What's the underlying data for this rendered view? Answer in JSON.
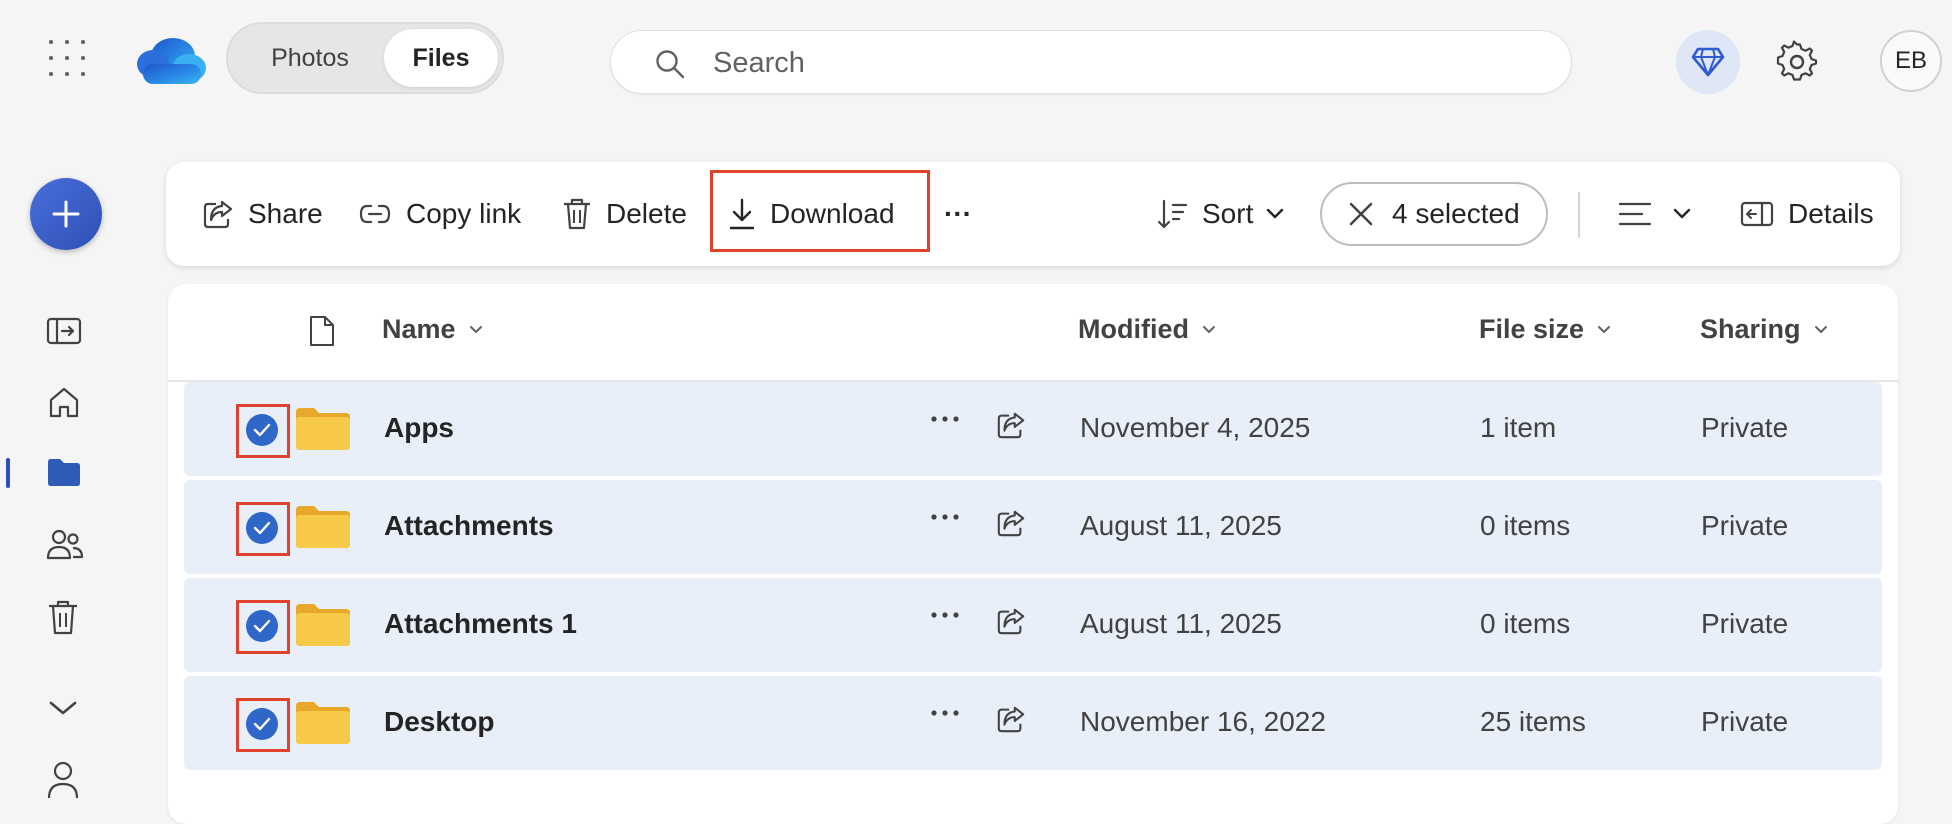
{
  "app": {
    "toggle": {
      "photos": "Photos",
      "files": "Files"
    },
    "search": {
      "placeholder": "Search"
    },
    "avatar_initials": "EB"
  },
  "toolbar": {
    "share": "Share",
    "copy_link": "Copy link",
    "delete": "Delete",
    "download": "Download",
    "more": "···",
    "sort": "Sort",
    "selected": "4 selected",
    "details": "Details"
  },
  "columns": {
    "name": "Name",
    "modified": "Modified",
    "file_size": "File size",
    "sharing": "Sharing"
  },
  "rows": [
    {
      "name": "Apps",
      "modified": "November 4, 2025",
      "size": "1 item",
      "sharing": "Private",
      "selected": true
    },
    {
      "name": "Attachments",
      "modified": "August 11, 2025",
      "size": "0 items",
      "sharing": "Private",
      "selected": true
    },
    {
      "name": "Attachments 1",
      "modified": "August 11, 2025",
      "size": "0 items",
      "sharing": "Private",
      "selected": true
    },
    {
      "name": "Desktop",
      "modified": "November 16, 2022",
      "size": "25 items",
      "sharing": "Private",
      "selected": true
    }
  ],
  "colors": {
    "accent": "#2f67c9",
    "highlight": "#e0432b",
    "row_selected": "#e9eff9",
    "folder": "#f5c443"
  },
  "icons": [
    "app-launcher-icon",
    "onedrive-logo",
    "search-icon",
    "premium-diamond-icon",
    "gear-icon",
    "plus-icon",
    "collapse-pane-icon",
    "home-icon",
    "folder-icon",
    "people-icon",
    "trash-icon",
    "chevron-down-icon",
    "person-icon",
    "share-icon",
    "link-icon",
    "download-icon",
    "sort-icon",
    "close-icon",
    "view-options-icon",
    "details-pane-icon",
    "file-icon",
    "checkmark-icon"
  ]
}
